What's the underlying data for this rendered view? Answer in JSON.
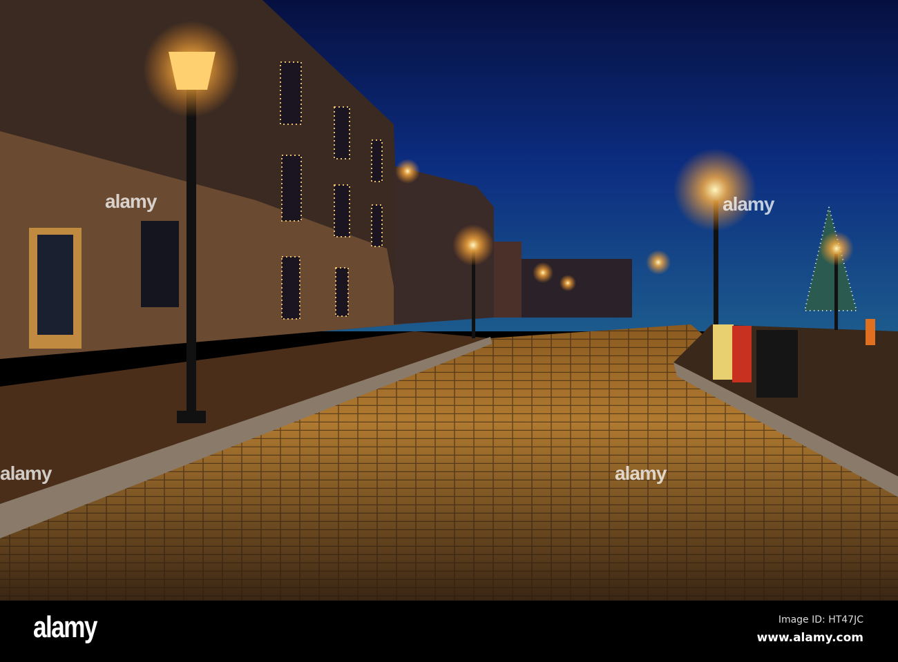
{
  "photo": {
    "description_label": "Cobblestone street at night",
    "sky_color": "#0c2a7a",
    "lamp_color": "#ffb347"
  },
  "watermark": {
    "text": "alamy"
  },
  "footer": {
    "logo": "alamy",
    "image_id": "Image ID: HT47JC",
    "url": "www.alamy.com"
  }
}
